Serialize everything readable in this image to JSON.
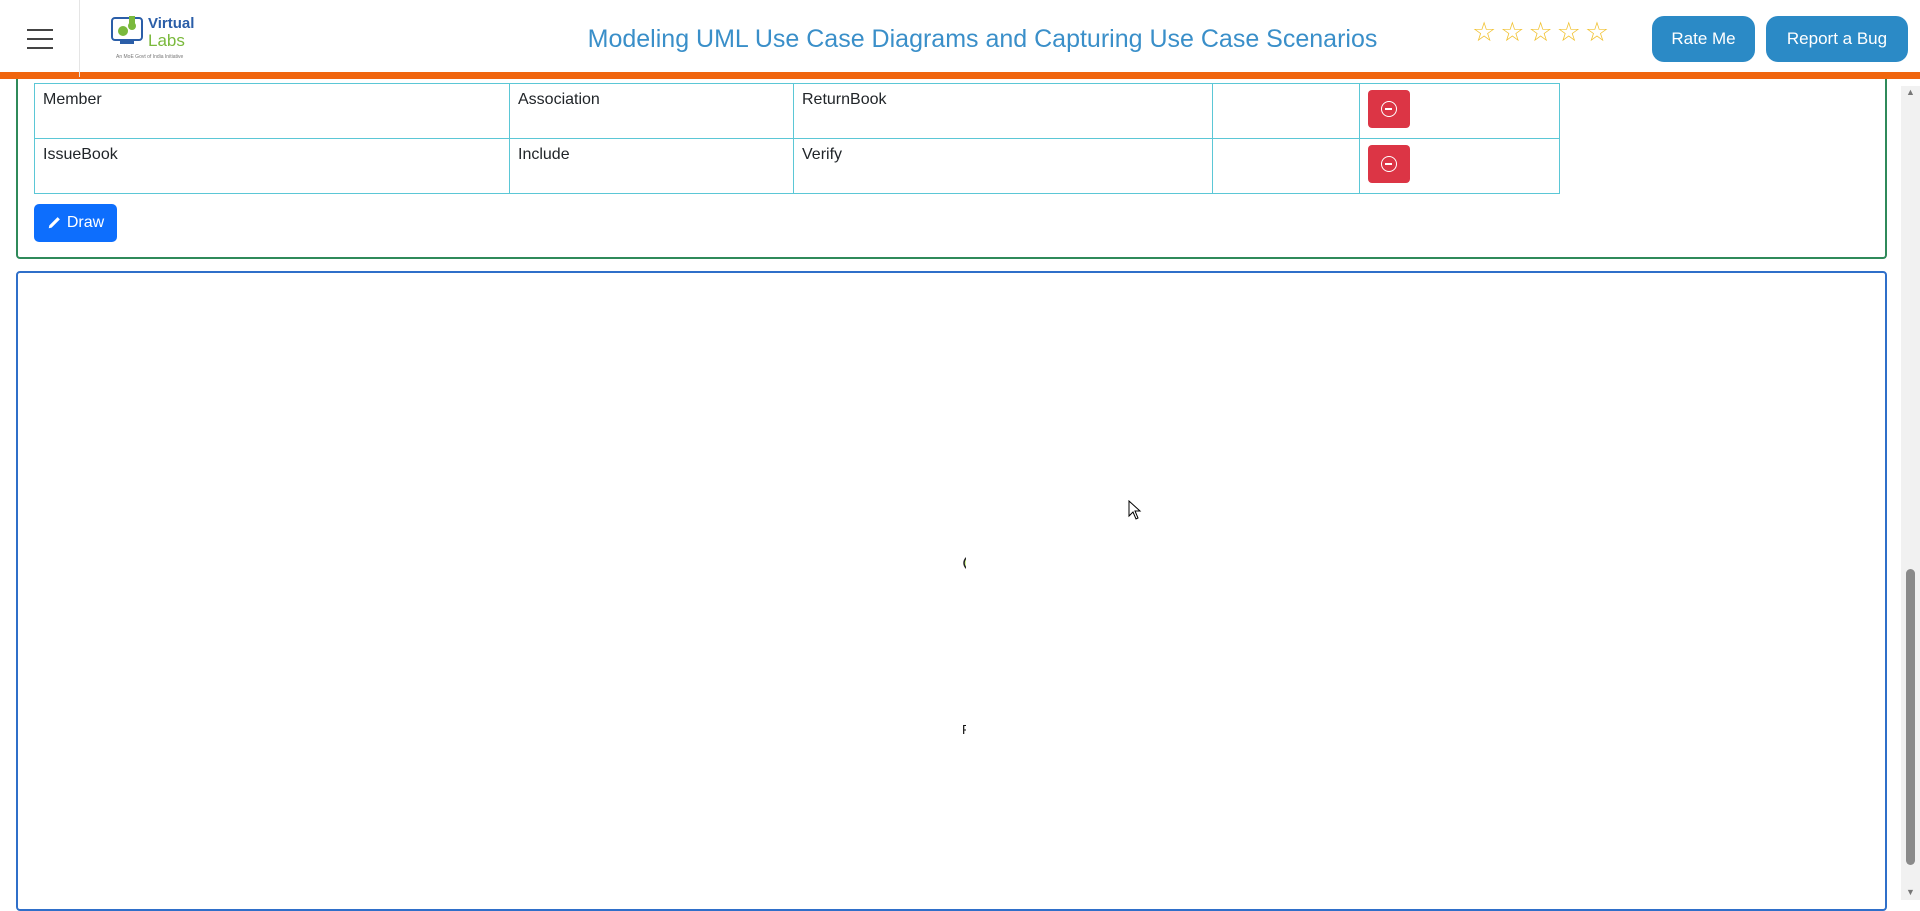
{
  "header": {
    "menu_icon": "hamburger-menu-icon",
    "logo": {
      "line1": "Virtual",
      "line2": "Labs",
      "tagline": "An MoE Govt of India Initiative"
    },
    "title": "Modeling UML Use Case Diagrams and Capturing Use Case Scenarios",
    "rating": {
      "stars": 5,
      "filled": 0,
      "icon": "star-outline-icon"
    },
    "rate_label": "Rate Me",
    "bug_label": "Report a Bug",
    "accent_color": "#f0650e",
    "button_color": "#2b8ac6"
  },
  "relations": {
    "rows": [
      {
        "from": "Member",
        "relation": "Association",
        "to": "ReturnBook",
        "extra": ""
      },
      {
        "from": "IssueBook",
        "relation": "Include",
        "to": "Verify",
        "extra": ""
      }
    ],
    "remove_icon": "minus-circle-icon",
    "remove_color": "#dc3545"
  },
  "actions": {
    "draw_label": "Draw",
    "draw_icon": "pencil-icon",
    "draw_color": "#0d6efd"
  },
  "canvas": {
    "nodes": [
      {
        "label": ""
      },
      {
        "label": "R"
      }
    ],
    "node_color": "#d4f59a"
  }
}
